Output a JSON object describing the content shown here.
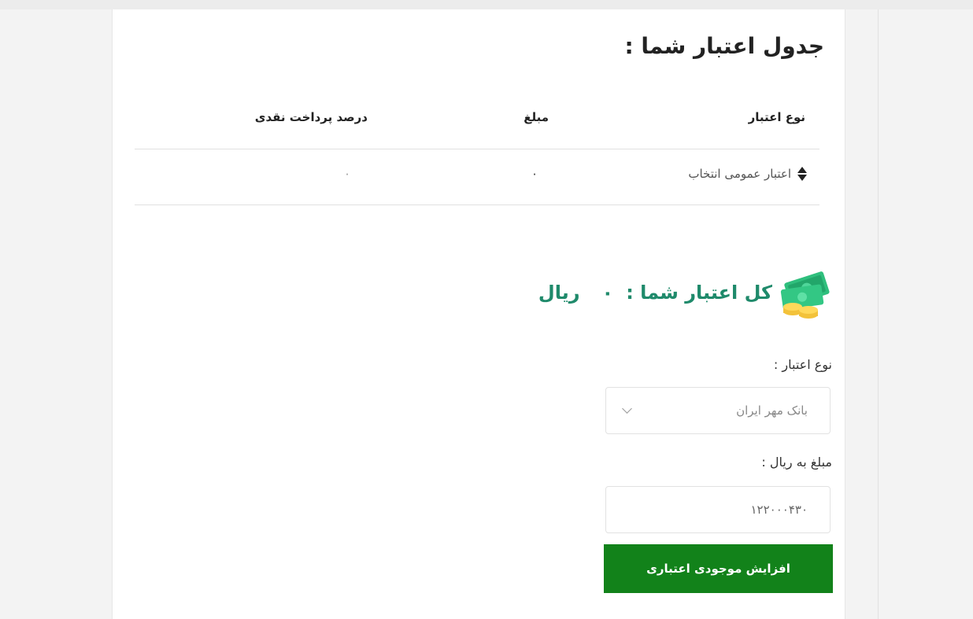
{
  "page": {
    "background": "#f3f3f3",
    "accent": "#1f8a6b",
    "button_color": "#12821a"
  },
  "table": {
    "title": "جدول اعتبار شما :",
    "headers": {
      "type": "نوع اعتبار",
      "amount": "مبلغ",
      "percent": "درصد پرداخت نقدی"
    },
    "rows": [
      {
        "type": "اعتبار عمومی انتخاب",
        "amount": "۰",
        "percent": "۰"
      }
    ]
  },
  "total": {
    "label": "کل اعتبار شما :",
    "value": "۰",
    "unit": "ریال",
    "icon": "money-icon"
  },
  "form": {
    "type_label": "نوع اعتبار :",
    "type_value": "بانک مهر ایران",
    "amount_label": "مبلغ به ریال :",
    "amount_value": "۱۲۲۰۰۰۴۳۰",
    "submit_label": "افزایش موجودی اعتباری"
  }
}
